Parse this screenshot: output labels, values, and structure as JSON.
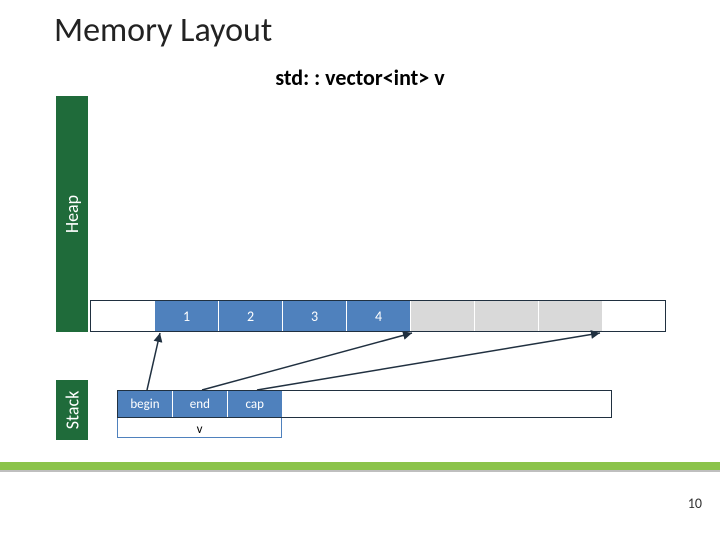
{
  "title": "Memory Layout",
  "subtitle": "std: : vector<int> v",
  "heap_label": "Heap",
  "stack_label": "Stack",
  "heap_cells": [
    "",
    "1",
    "2",
    "3",
    "4",
    "",
    "",
    "",
    ""
  ],
  "heap_cell_kinds": [
    "blank",
    "data",
    "data",
    "data",
    "data",
    "spare",
    "spare",
    "spare",
    "tail"
  ],
  "stack_cells": [
    "begin",
    "end",
    "cap",
    "",
    "",
    "",
    "",
    "",
    ""
  ],
  "stack_cell_kinds": [
    "ptr",
    "ptr",
    "ptr",
    "blank",
    "blank",
    "blank",
    "blank",
    "blank",
    "blank"
  ],
  "v_label": "v",
  "page_number": "10",
  "chart_data": {
    "type": "table",
    "title": "std::vector<int> v memory layout",
    "heap_array": {
      "values": [
        1,
        2,
        3,
        4
      ],
      "capacity": 7
    },
    "stack_object": {
      "fields": [
        "begin",
        "end",
        "cap"
      ],
      "name": "v"
    },
    "pointers": [
      {
        "from": "begin",
        "to_index": 0
      },
      {
        "from": "end",
        "to_index": 4
      },
      {
        "from": "cap",
        "to_index": 7
      }
    ]
  }
}
